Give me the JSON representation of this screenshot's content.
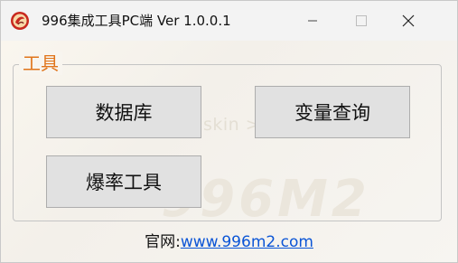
{
  "window": {
    "title": "996集成工具PC端 Ver 1.0.0.1",
    "app_icon": "app-logo-icon",
    "controls": {
      "minimize_icon": "minimize-icon",
      "maximize_icon": "maximize-icon",
      "close_icon": "close-icon"
    }
  },
  "group": {
    "title": "工具",
    "buttons": [
      {
        "label": "数据库"
      },
      {
        "label": "变量查询"
      },
      {
        "label": "爆率工具"
      }
    ]
  },
  "footer": {
    "prefix": "官网:",
    "link": "www.996m2.com"
  },
  "watermark": {
    "text": "skin >",
    "logo_text": "996M2"
  },
  "colors": {
    "accent": "#e0741a",
    "link": "#0b55d6",
    "button_bg": "#e1e1e1",
    "button_border": "#adadad"
  }
}
